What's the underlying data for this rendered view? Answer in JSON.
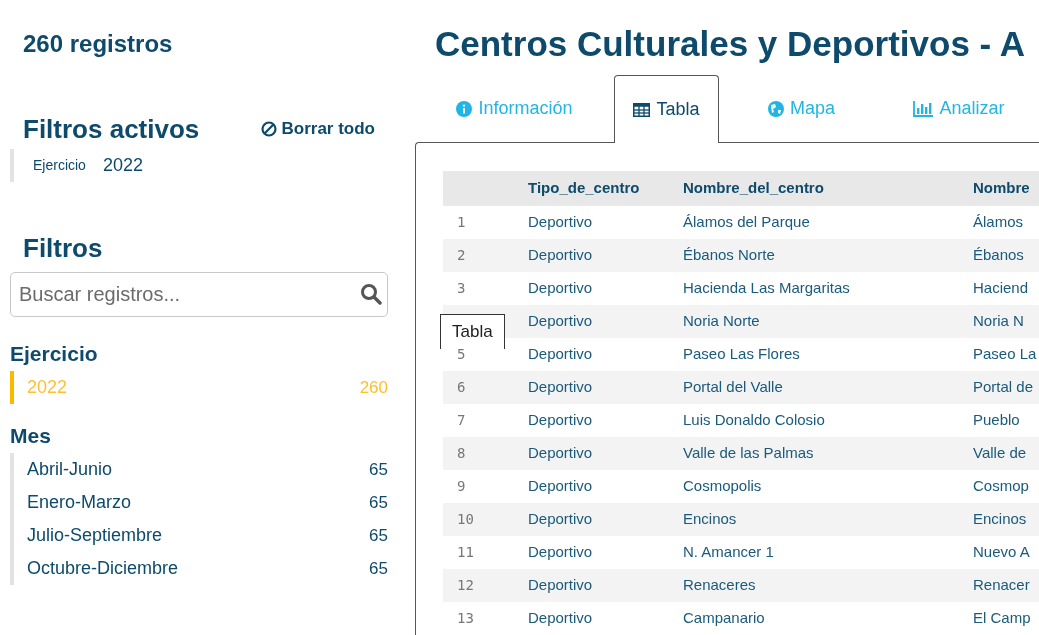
{
  "sidebar": {
    "record_count": "260 registros",
    "active_filters": {
      "title": "Filtros activos",
      "clear_all": "Borrar todo",
      "items": [
        {
          "field": "Ejercicio",
          "value": "2022"
        }
      ]
    },
    "filters": {
      "title": "Filtros",
      "search": {
        "placeholder": "Buscar registros..."
      },
      "groups": [
        {
          "title": "Ejercicio",
          "options": [
            {
              "label": "2022",
              "count": "260",
              "selected": true
            }
          ]
        },
        {
          "title": "Mes",
          "options": [
            {
              "label": "Abril-Junio",
              "count": "65",
              "selected": false
            },
            {
              "label": "Enero-Marzo",
              "count": "65",
              "selected": false
            },
            {
              "label": "Julio-Septiembre",
              "count": "65",
              "selected": false
            },
            {
              "label": "Octubre-Diciembre",
              "count": "65",
              "selected": false
            }
          ]
        }
      ]
    }
  },
  "main": {
    "title": "Centros Culturales y Deportivos - A",
    "tabs": [
      {
        "label": "Información",
        "kind": "info",
        "selected": false
      },
      {
        "label": "Tabla",
        "kind": "table",
        "selected": true
      },
      {
        "label": "Mapa",
        "kind": "globe",
        "selected": false
      },
      {
        "label": "Analizar",
        "kind": "chart",
        "selected": false
      }
    ],
    "tooltip": "Tabla",
    "table": {
      "columns": [
        "Tipo_de_centro",
        "Nombre_del_centro",
        "Nombre"
      ],
      "rows": [
        {
          "number": "1",
          "cells": [
            "Deportivo",
            "Álamos del Parque",
            "Álamos"
          ]
        },
        {
          "number": "2",
          "cells": [
            "Deportivo",
            "Ébanos Norte",
            "Ébanos"
          ]
        },
        {
          "number": "3",
          "cells": [
            "Deportivo",
            "Hacienda Las Margaritas",
            "Haciend"
          ]
        },
        {
          "cells": [
            "Deportivo",
            "Noria Norte",
            "Noria N"
          ]
        },
        {
          "number": "5",
          "cells": [
            "Deportivo",
            "Paseo Las Flores",
            "Paseo La"
          ]
        },
        {
          "number": "6",
          "cells": [
            "Deportivo",
            "Portal del Valle",
            "Portal de"
          ]
        },
        {
          "number": "7",
          "cells": [
            "Deportivo",
            "Luis Donaldo Colosio",
            "Pueblo"
          ]
        },
        {
          "number": "8",
          "cells": [
            "Deportivo",
            "Valle de las Palmas",
            "Valle de"
          ]
        },
        {
          "number": "9",
          "cells": [
            "Deportivo",
            "Cosmopolis",
            "Cosmop"
          ]
        },
        {
          "number": "10",
          "cells": [
            "Deportivo",
            "Encinos",
            "Encinos"
          ]
        },
        {
          "number": "11",
          "cells": [
            "Deportivo",
            "N. Amancer 1",
            "Nuevo A"
          ]
        },
        {
          "number": "12",
          "cells": [
            "Deportivo",
            "Renaceres",
            "Renacer"
          ]
        },
        {
          "number": "13",
          "cells": [
            "Deportivo",
            "Campanario",
            "El Camp"
          ]
        }
      ]
    }
  }
}
